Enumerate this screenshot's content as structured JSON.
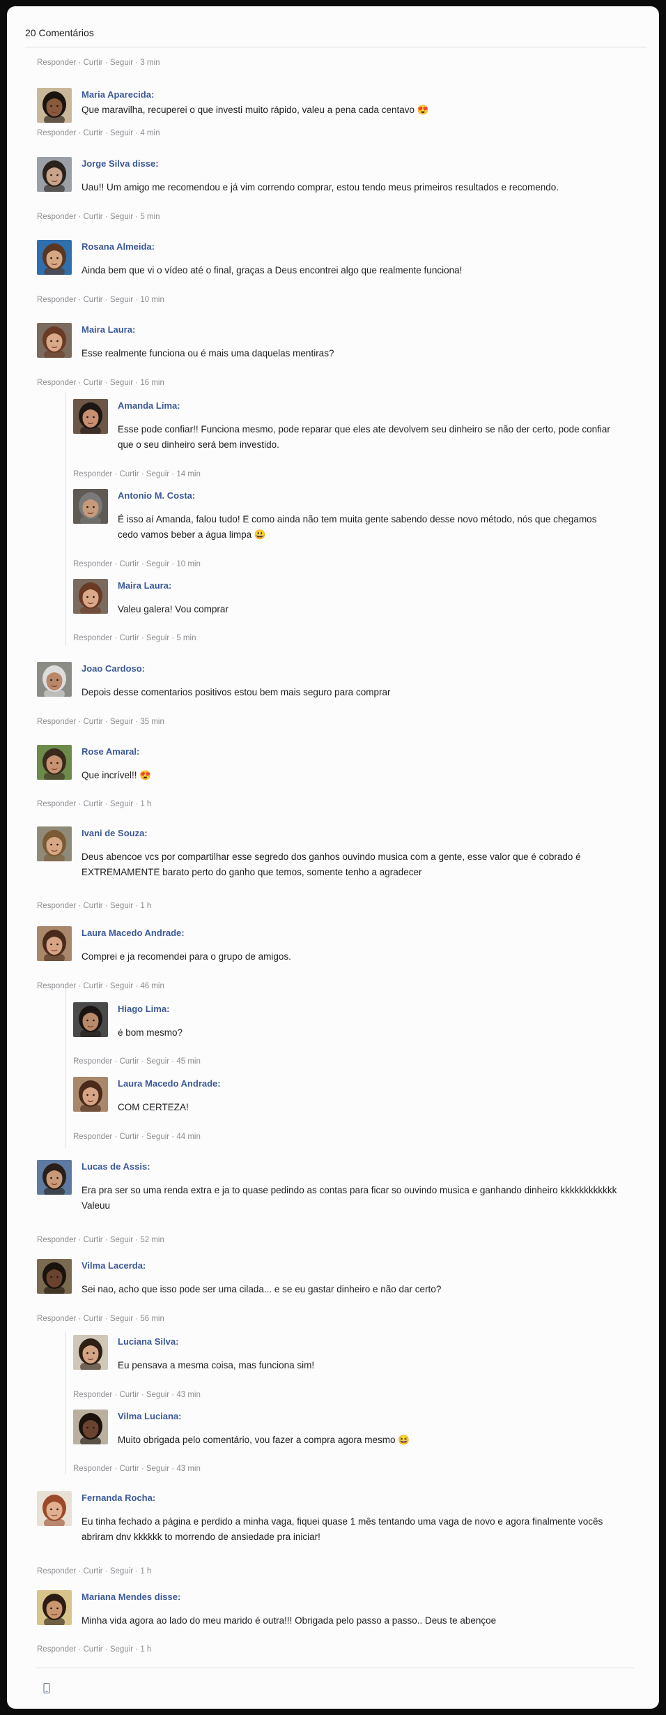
{
  "header": {
    "count_label": "20 Comentários"
  },
  "actions": {
    "reply": "Responder",
    "like": "Curtir",
    "follow": "Seguir",
    "sep": " · "
  },
  "first_meta_time": "3 min",
  "comments": [
    {
      "name": "Maria Aparecida:",
      "text": "Que maravilha, recuperei o que investi muito rápido, valeu a pena cada centavo 😍",
      "time": "4 min",
      "avatar": {
        "skin": "#8a5a3c",
        "hair": "#1a1410",
        "bg": "#c9b79a"
      }
    },
    {
      "name": "Jorge Silva disse:",
      "text": "Uau!! Um amigo me recomendou e já vim correndo comprar, estou tendo meus primeiros resultados e recomendo.",
      "time": "5 min",
      "avatar": {
        "skin": "#c9a48a",
        "hair": "#2a221c",
        "bg": "#9aa0a6"
      }
    },
    {
      "name": "Rosana Almeida:",
      "text": "Ainda bem que vi o vídeo até o final, graças a Deus encontrei algo que realmente funciona!",
      "time": "10 min",
      "avatar": {
        "skin": "#d6a783",
        "hair": "#5a3620",
        "bg": "#2f6fae"
      }
    },
    {
      "name": "Maira Laura:",
      "text": "Esse realmente funciona ou é mais uma daquelas mentiras?",
      "time": "16 min",
      "avatar": {
        "skin": "#d9a98a",
        "hair": "#6a3a24",
        "bg": "#7a6b5e"
      }
    },
    {
      "name": "Amanda Lima:",
      "text": "Esse pode confiar!! Funciona mesmo, pode reparar que eles ate devolvem seu dinheiro se não der certo, pode confiar que o seu dinheiro será bem investido.",
      "time": "14 min",
      "avatar": {
        "skin": "#c89070",
        "hair": "#1e1612",
        "bg": "#6b5647"
      }
    },
    {
      "name": "Antonio M. Costa:",
      "text": "É isso aí Amanda, falou tudo! E como ainda não tem muita gente sabendo desse novo método, nós que chegamos cedo vamos beber a água limpa 😃",
      "time": "10 min",
      "avatar": {
        "skin": "#c79a7a",
        "hair": "#7a7a7a",
        "bg": "#5f5a54"
      }
    },
    {
      "name": "Maira Laura:",
      "text": "Valeu galera! Vou comprar",
      "time": "5 min",
      "avatar": {
        "skin": "#d9a98a",
        "hair": "#6a3a24",
        "bg": "#7a6b5e"
      }
    },
    {
      "name": "Joao Cardoso:",
      "text": "Depois desse comentarios positivos estou bem mais seguro para comprar",
      "time": "35 min",
      "avatar": {
        "skin": "#b9876a",
        "hair": "#dcdcdc",
        "bg": "#8c8c86"
      }
    },
    {
      "name": "Rose Amaral:",
      "text": "Que incrível!! 😍",
      "time": "1 h",
      "avatar": {
        "skin": "#c79372",
        "hair": "#3a2a1e",
        "bg": "#6c8a4a"
      }
    },
    {
      "name": "Ivani de Souza:",
      "text": "Deus abencoe vcs por compartilhar esse segredo dos ganhos ouvindo musica com a gente, esse valor que é cobrado é EXTREMAMENTE barato perto do ganho que temos, somente tenho a agradecer",
      "time": "1 h",
      "avatar": {
        "skin": "#d6a784",
        "hair": "#7a5a34",
        "bg": "#8f8a78"
      }
    },
    {
      "name": "Laura Macedo Andrade:",
      "text": "Comprei e ja recomendei para o grupo de amigos.",
      "time": "46 min",
      "avatar": {
        "skin": "#d7a486",
        "hair": "#4a2a1a",
        "bg": "#a9876a"
      }
    },
    {
      "name": "Hiago Lima:",
      "text": "é bom mesmo?",
      "time": "45 min",
      "avatar": {
        "skin": "#b98a6a",
        "hair": "#1a1512",
        "bg": "#4a4a4a"
      }
    },
    {
      "name": "Laura Macedo Andrade:",
      "text": "COM CERTEZA!",
      "time": "44 min",
      "avatar": {
        "skin": "#d7a486",
        "hair": "#4a2a1a",
        "bg": "#a9876a"
      }
    },
    {
      "name": "Lucas de Assis:",
      "text": "Era pra ser so uma renda extra e ja to quase pedindo as contas para ficar so ouvindo musica e ganhando dinheiro kkkkkkkkkkkk Valeuu",
      "time": "52 min",
      "avatar": {
        "skin": "#c89a7a",
        "hair": "#2a1f18",
        "bg": "#5e7aa0"
      }
    },
    {
      "name": "Vilma Lacerda:",
      "text": "Sei nao, acho que isso pode ser uma cilada... e se eu gastar dinheiro e não dar certo?",
      "time": "56 min",
      "avatar": {
        "skin": "#6a4330",
        "hair": "#1a120c",
        "bg": "#7a6a50"
      }
    },
    {
      "name": "Luciana Silva:",
      "text": "Eu pensava a mesma coisa, mas funciona sim!",
      "time": "43 min",
      "avatar": {
        "skin": "#d4a484",
        "hair": "#2e1e14",
        "bg": "#cfc7b8"
      }
    },
    {
      "name": "Vilma Luciana:",
      "text": "Muito obrigada pelo comentário, vou fazer a compra agora mesmo 😆",
      "time": "43 min",
      "avatar": {
        "skin": "#6a4330",
        "hair": "#1a120c",
        "bg": "#b9b0a0"
      }
    },
    {
      "name": "Fernanda Rocha:",
      "text": "Eu tinha fechado a página e perdido a minha vaga, fiquei quase 1 mês tentando uma vaga de novo e agora finalmente vocês abriram dnv kkkkkk to morrendo de ansiedade pra iniciar!",
      "time": "1 h",
      "avatar": {
        "skin": "#e0b090",
        "hair": "#9a4a2a",
        "bg": "#e8e0d4"
      }
    },
    {
      "name": "Mariana Mendes disse:",
      "text": "Minha vida agora ao lado do meu marido é outra!!! Obrigada pelo passo a passo.. Deus te abençoe",
      "time": "1 h",
      "avatar": {
        "skin": "#c9966e",
        "hair": "#2a1c14",
        "bg": "#d8c48a"
      }
    }
  ]
}
